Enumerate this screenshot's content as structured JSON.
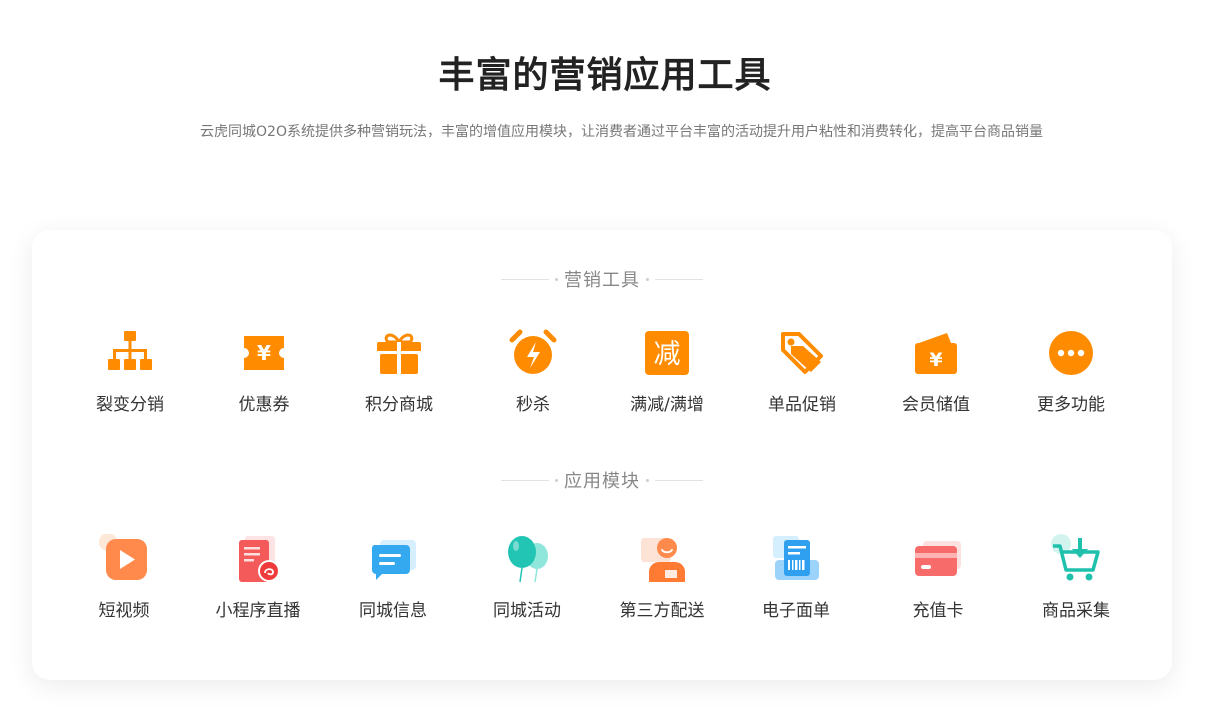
{
  "page": {
    "title": "丰富的营销应用工具",
    "subtitle": "云虎同城O2O系统提供多种营销玩法，丰富的增值应用模块，让消费者通过平台丰富的活动提升用户粘性和消费转化，提高平台商品销量"
  },
  "sections": [
    {
      "title": "营销工具",
      "items": [
        {
          "label": "裂变分销",
          "icon": "org-chart-icon"
        },
        {
          "label": "优惠券",
          "icon": "coupon-icon"
        },
        {
          "label": "积分商城",
          "icon": "gift-box-icon"
        },
        {
          "label": "秒杀",
          "icon": "alarm-clock-icon"
        },
        {
          "label": "满减/满增",
          "icon": "discount-icon",
          "glyph": "减"
        },
        {
          "label": "单品促销",
          "icon": "price-tag-icon"
        },
        {
          "label": "会员储值",
          "icon": "wallet-icon",
          "glyph": "¥"
        },
        {
          "label": "更多功能",
          "icon": "more-icon"
        }
      ]
    },
    {
      "title": "应用模块",
      "items": [
        {
          "label": "短视频",
          "icon": "play-video-icon"
        },
        {
          "label": "小程序直播",
          "icon": "mini-program-live-icon"
        },
        {
          "label": "同城信息",
          "icon": "chat-message-icon"
        },
        {
          "label": "同城活动",
          "icon": "balloons-icon"
        },
        {
          "label": "第三方配送",
          "icon": "delivery-person-icon"
        },
        {
          "label": "电子面单",
          "icon": "barcode-receipt-icon"
        },
        {
          "label": "充值卡",
          "icon": "card-icon"
        },
        {
          "label": "商品采集",
          "icon": "cart-download-icon"
        }
      ]
    }
  ],
  "colors": {
    "orange": "#ff8c00",
    "title": "#222222",
    "subtitle": "#777777"
  }
}
